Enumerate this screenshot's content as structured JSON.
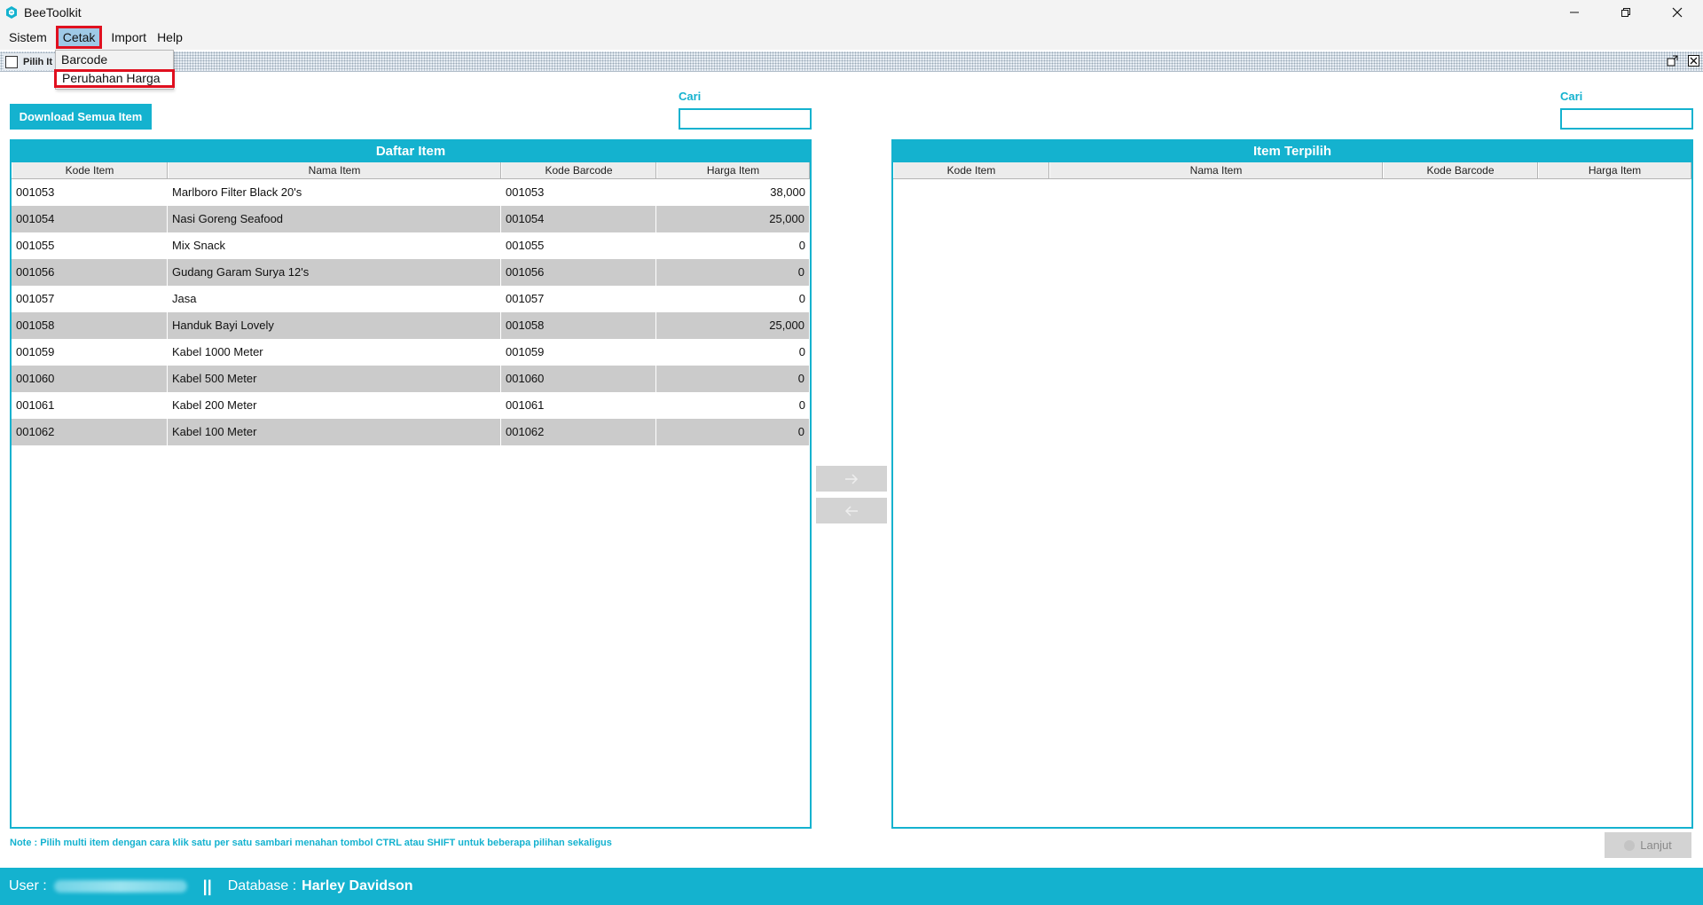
{
  "app": {
    "title": "BeeToolkit"
  },
  "menu": {
    "items": [
      "Sistem",
      "Cetak",
      "Import",
      "Help"
    ],
    "cetak_dropdown": [
      "Barcode",
      "Perubahan Harga"
    ]
  },
  "internal_frame": {
    "title": "Pilih It"
  },
  "toolbar": {
    "download_label": "Download Semua Item"
  },
  "search": {
    "left_label": "Cari",
    "right_label": "Cari",
    "left_value": "",
    "right_value": ""
  },
  "left_table": {
    "title": "Daftar Item",
    "columns": [
      "Kode Item",
      "Nama Item",
      "Kode Barcode",
      "Harga Item"
    ],
    "rows": [
      [
        "001053",
        "Marlboro Filter Black 20's",
        "001053",
        "38,000"
      ],
      [
        "001054",
        "Nasi Goreng Seafood",
        "001054",
        "25,000"
      ],
      [
        "001055",
        "Mix Snack",
        "001055",
        "0"
      ],
      [
        "001056",
        "Gudang Garam Surya 12's",
        "001056",
        "0"
      ],
      [
        "001057",
        "Jasa",
        "001057",
        "0"
      ],
      [
        "001058",
        "Handuk Bayi Lovely",
        "001058",
        "25,000"
      ],
      [
        "001059",
        "Kabel 1000 Meter",
        "001059",
        "0"
      ],
      [
        "001060",
        "Kabel 500 Meter",
        "001060",
        "0"
      ],
      [
        "001061",
        "Kabel 200 Meter",
        "001061",
        "0"
      ],
      [
        "001062",
        "Kabel 100 Meter",
        "001062",
        "0"
      ]
    ]
  },
  "right_table": {
    "title": "Item Terpilih",
    "columns": [
      "Kode Item",
      "Nama Item",
      "Kode Barcode",
      "Harga Item"
    ]
  },
  "footer": {
    "note": "Note : Pilih multi item dengan cara klik satu per satu sambari menahan tombol CTRL atau SHIFT untuk beberapa pilihan sekaligus",
    "next_label": "Lanjut"
  },
  "status": {
    "user_label": "User :",
    "separator": "||",
    "db_label": "Database :",
    "db_value": "Harley Davidson"
  },
  "colors": {
    "accent": "#14b2cf",
    "highlight": "#e0101f",
    "row_alt": "#cbcbcb"
  }
}
